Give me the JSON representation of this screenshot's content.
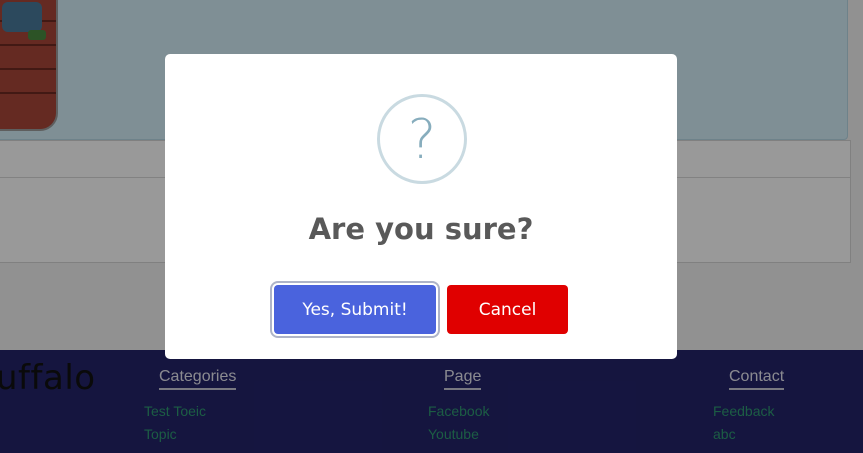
{
  "footer": {
    "brand": "uffalo",
    "columns": [
      {
        "heading": "Categories",
        "links": [
          "Test Toeic",
          "Topic"
        ]
      },
      {
        "heading": "Page",
        "links": [
          "Facebook",
          "Youtube"
        ]
      },
      {
        "heading": "Contact",
        "links": [
          "Feedback",
          "abc"
        ]
      }
    ]
  },
  "modal": {
    "icon": "question-icon",
    "icon_glyph": "?",
    "title": "Are you sure?",
    "confirm_label": "Yes, Submit!",
    "cancel_label": "Cancel"
  },
  "colors": {
    "confirm": "#4a63dd",
    "cancel": "#e00000",
    "footer_bg": "#23236a",
    "footer_link": "#2f9b72"
  }
}
